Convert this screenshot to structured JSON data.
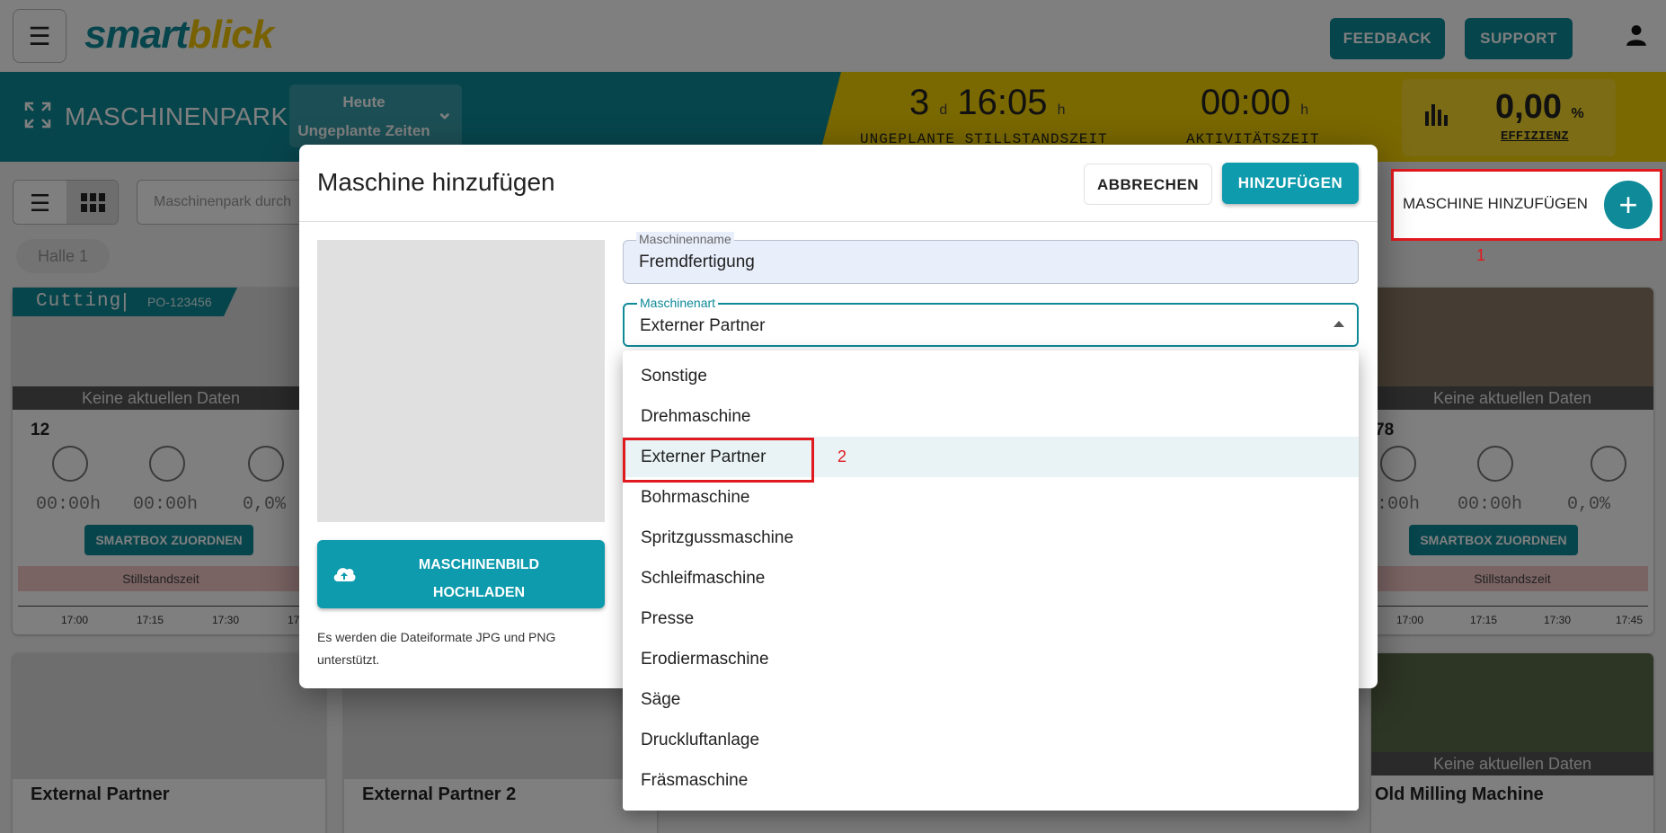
{
  "topbar": {
    "logo_part1": "smart",
    "logo_part2": "blick",
    "feedback_label": "FEEDBACK",
    "support_label": "SUPPORT"
  },
  "header": {
    "title": "MASCHINENPARK",
    "period_line1": "Heute",
    "period_line2": "Ungeplante Zeiten",
    "kpi1_days": "3",
    "kpi1_days_unit": "d",
    "kpi1_time": "16:05",
    "kpi1_time_unit": "h",
    "kpi1_label": "UNGEPLANTE STILLSTANDSZEIT",
    "kpi2_time": "00:00",
    "kpi2_unit": "h",
    "kpi2_label": "AKTIVITÄTSZEIT",
    "efficiency_value": "0,00",
    "efficiency_unit": "%",
    "efficiency_label": "EFFIZIENZ"
  },
  "toolbar": {
    "search_placeholder": "Maschinenpark durch",
    "hall_chip": "Halle 1",
    "add_machine_label": "MASCHINE HINZUFÜGEN",
    "annotation_1": "1",
    "annotation_2": "2"
  },
  "cards": {
    "card1": {
      "tag": "Cutting",
      "order": "PO-123456",
      "no_data": "Keine aktuellen Daten",
      "number": "12",
      "val1": "00:00h",
      "val2": "00:00h",
      "val3": "0,0%",
      "button": "SMARTBOX ZUORDNEN",
      "status": "Stillstandszeit",
      "ticks": [
        "17:00",
        "17:15",
        "17:30",
        "17"
      ]
    },
    "card2": {
      "no_data": "Keine aktuellen Daten",
      "number": "78",
      "val1": ":00h",
      "val2": "00:00h",
      "val3": "0,0%",
      "button": "SMARTBOX ZUORDNEN",
      "status": "Stillstandszeit",
      "ticks": [
        "17:00",
        "17:15",
        "17:30",
        "17:45"
      ]
    },
    "bottom1_title": "External Partner",
    "bottom2_title": "External Partner 2",
    "bottom3_no_data": "Keine aktuellen Daten",
    "bottom3_title": "Old Milling Machine"
  },
  "dialog": {
    "title": "Maschine hinzufügen",
    "cancel_label": "ABBRECHEN",
    "add_label": "HINZUFÜGEN",
    "upload_label_line1": "MASCHINENBILD",
    "upload_label_line2": "HOCHLADEN",
    "upload_hint": "Es werden die Dateiformate JPG und PNG unterstützt.",
    "name_label": "Maschinenname",
    "name_value": "Fremdfertigung",
    "type_label": "Maschinenart",
    "type_value": "Externer Partner"
  },
  "dropdown": {
    "options": [
      "Sonstige",
      "Drehmaschine",
      "Externer Partner",
      "Bohrmaschine",
      "Spritzgussmaschine",
      "Schleifmaschine",
      "Presse",
      "Erodiermaschine",
      "Säge",
      "Druckluftanlage",
      "Fräsmaschine"
    ],
    "selected": "Externer Partner"
  },
  "colors": {
    "primary": "#0e8a98",
    "accent_yellow": "#f5d000",
    "highlight_red": "#e0191e"
  }
}
